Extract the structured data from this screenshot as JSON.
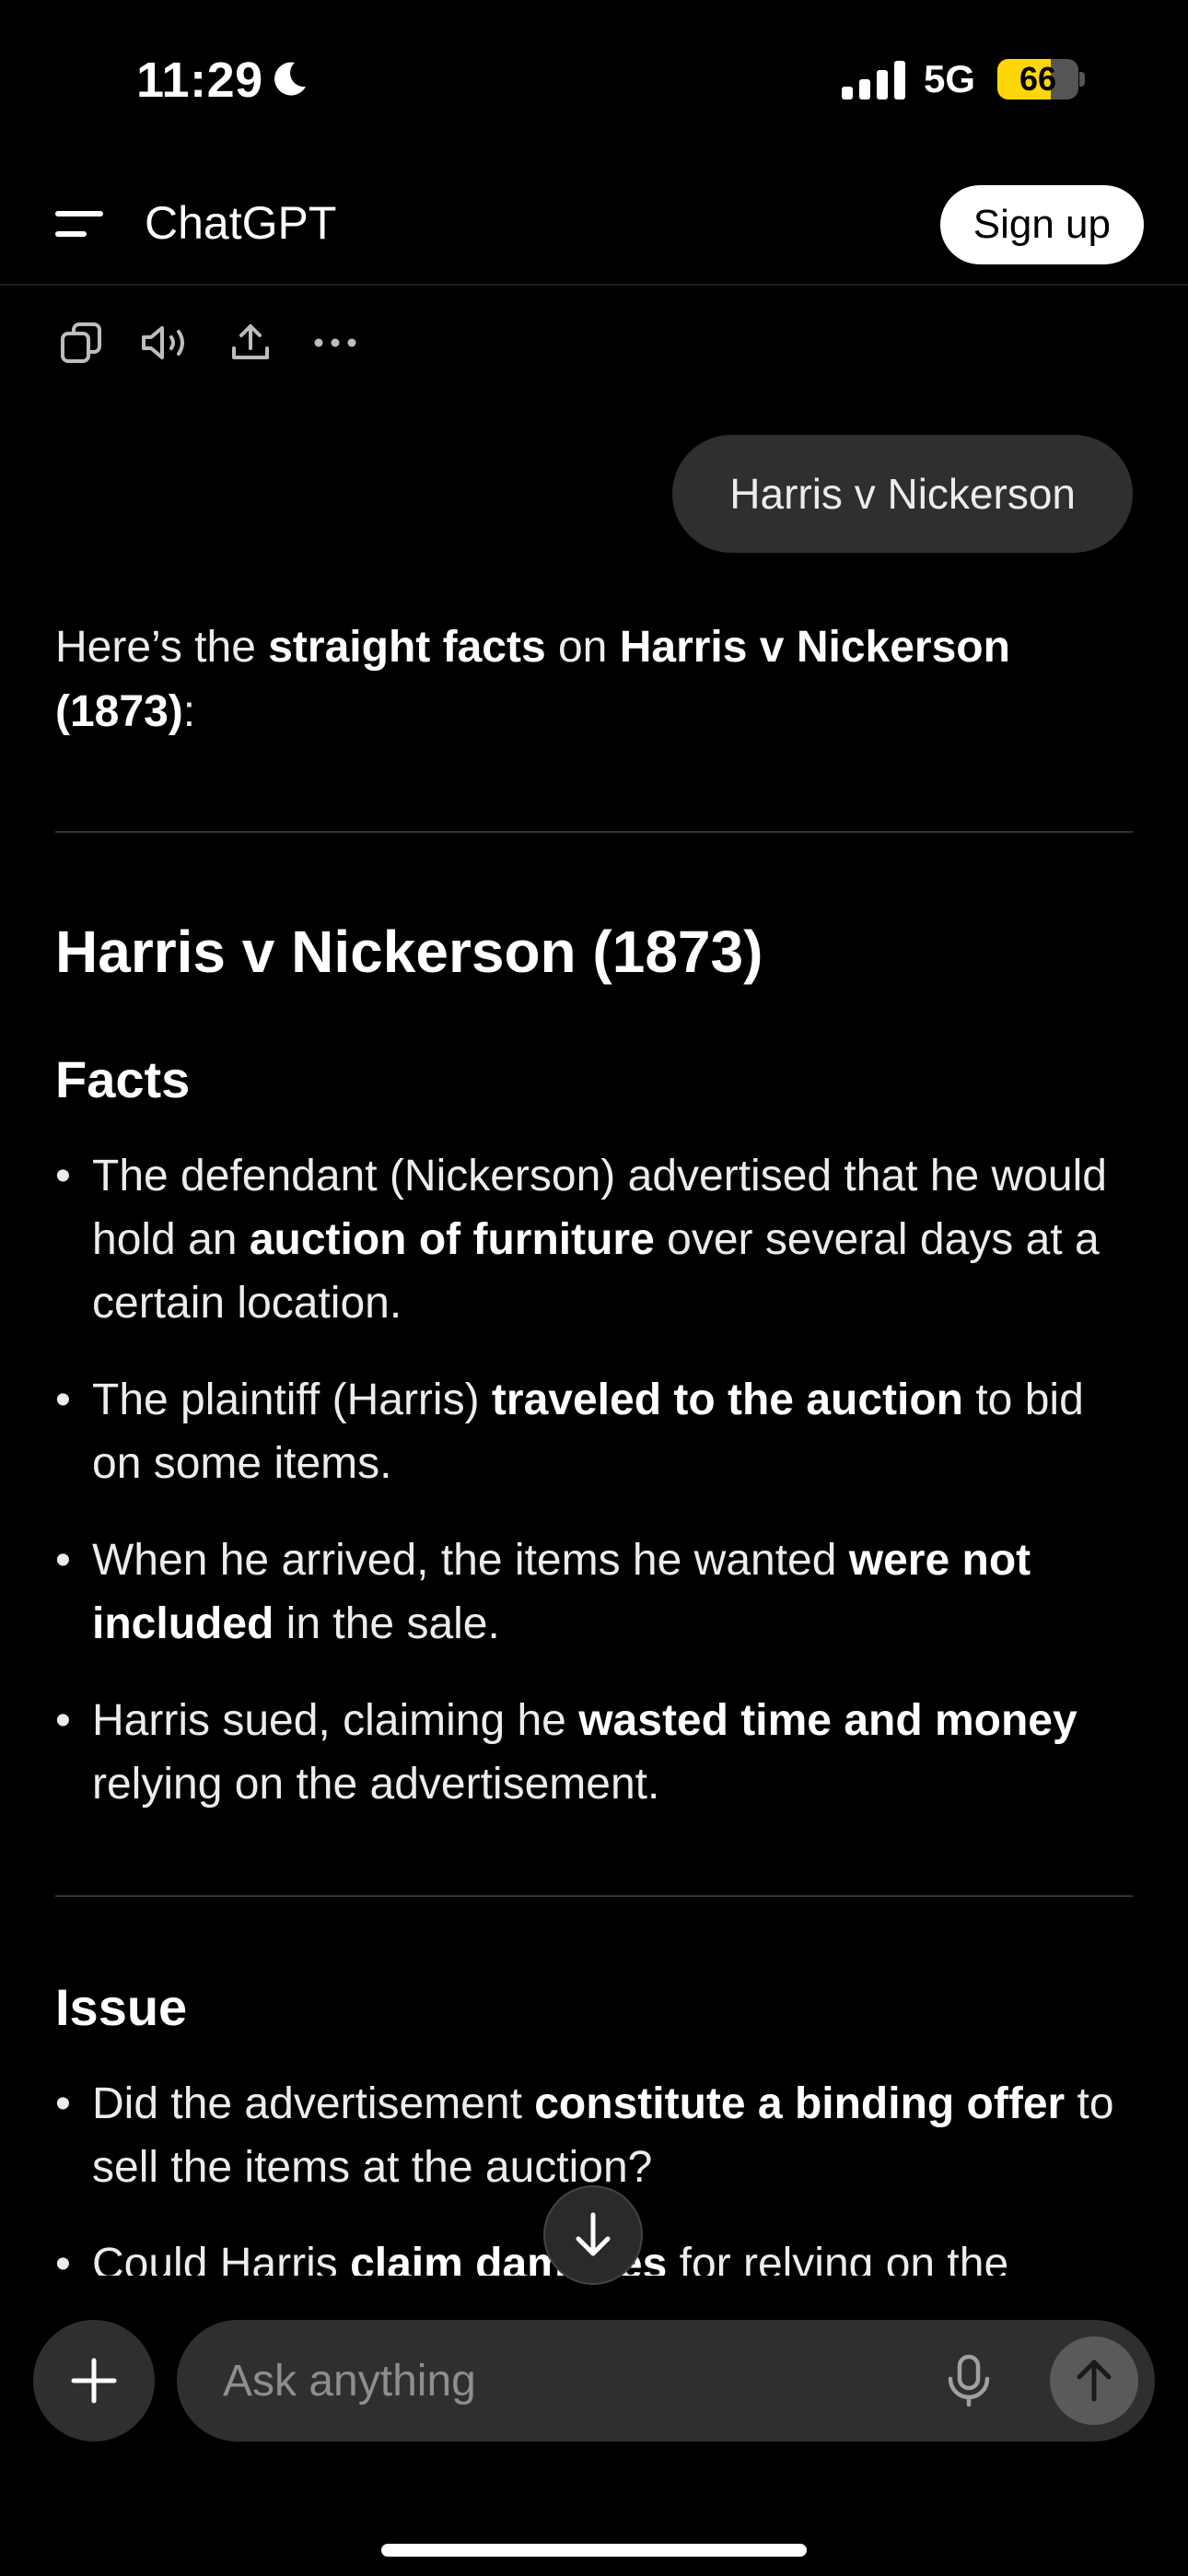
{
  "status_bar": {
    "time": "11:29",
    "network": "5G",
    "battery": "66",
    "battery_level": 0.66
  },
  "header": {
    "title": "ChatGPT",
    "signup_label": "Sign up"
  },
  "actions": [
    "copy-icon",
    "speaker-icon",
    "share-icon",
    "more-icon"
  ],
  "user_message": "Harris v Nickerson",
  "assistant": {
    "intro": [
      {
        "t": "Here’s the ",
        "b": false
      },
      {
        "t": "straight facts",
        "b": true
      },
      {
        "t": " on ",
        "b": false
      },
      {
        "t": "Harris v Nickerson (1873)",
        "b": true
      },
      {
        "t": ":",
        "b": false
      }
    ],
    "heading": "Harris v Nickerson (1873)",
    "sections": [
      {
        "title": "Facts",
        "bullets": [
          [
            {
              "t": "The defendant (Nickerson) advertised that he would hold an ",
              "b": false
            },
            {
              "t": "auction of furniture",
              "b": true
            },
            {
              "t": " over several days at a certain location.",
              "b": false
            }
          ],
          [
            {
              "t": "The plaintiff (Harris) ",
              "b": false
            },
            {
              "t": "traveled to the auction",
              "b": true
            },
            {
              "t": " to bid on some items.",
              "b": false
            }
          ],
          [
            {
              "t": "When he arrived, the items he wanted ",
              "b": false
            },
            {
              "t": "were not included",
              "b": true
            },
            {
              "t": " in the sale.",
              "b": false
            }
          ],
          [
            {
              "t": "Harris sued, claiming he ",
              "b": false
            },
            {
              "t": "wasted time and money",
              "b": true
            },
            {
              "t": " relying on the advertisement.",
              "b": false
            }
          ]
        ]
      },
      {
        "title": "Issue",
        "bullets": [
          [
            {
              "t": "Did the advertisement ",
              "b": false
            },
            {
              "t": "constitute a binding offer",
              "b": true
            },
            {
              "t": " to sell the items at the auction?",
              "b": false
            }
          ],
          [
            {
              "t": "Could Harris ",
              "b": false
            },
            {
              "t": "claim damages",
              "b": true
            },
            {
              "t": " for relying on the",
              "b": false
            }
          ]
        ]
      }
    ]
  },
  "composer": {
    "placeholder": "Ask anything"
  }
}
